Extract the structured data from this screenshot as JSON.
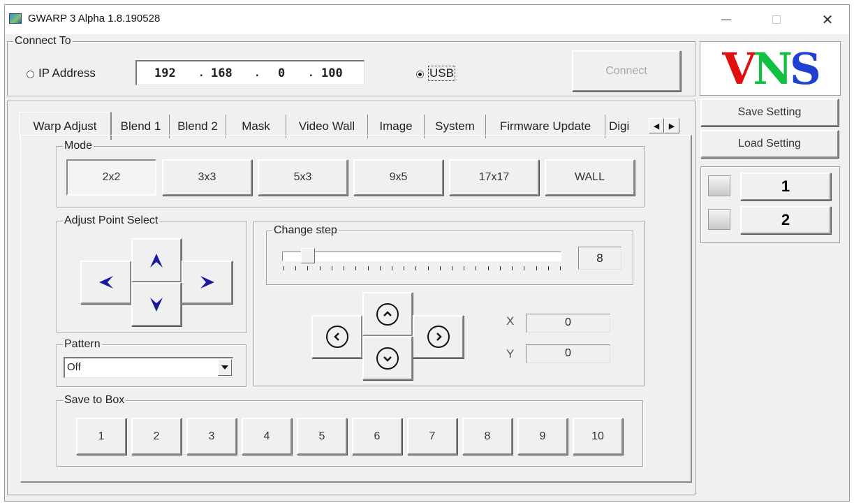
{
  "window": {
    "title": "GWARP 3 Alpha 1.8.190528",
    "minimize_icon": "minimize-icon",
    "maximize_icon": "maximize-icon",
    "close_icon": "close-icon",
    "close_glyph": "✕"
  },
  "connect": {
    "group_label": "Connect To",
    "ip_label": "IP Address",
    "ip_selected": false,
    "ip_octets": [
      "192",
      "168",
      "0",
      "100"
    ],
    "ip_separator": ".",
    "usb_label": "USB",
    "usb_selected": true,
    "connect_button": "Connect"
  },
  "logo": {
    "letters": [
      "V",
      "N",
      "S"
    ],
    "colors": [
      "#e01010",
      "#10c040",
      "#2040d0"
    ]
  },
  "settings": {
    "save": "Save Setting",
    "load": "Load Setting"
  },
  "channels": [
    "1",
    "2"
  ],
  "tabs": {
    "items": [
      "Warp Adjust",
      "Blend 1",
      "Blend 2",
      "Mask",
      "Video Wall",
      "Image",
      "System",
      "Firmware Update",
      "Digi"
    ],
    "active_index": 0,
    "scroll_left": "◀",
    "scroll_right": "▶"
  },
  "mode": {
    "group_label": "Mode",
    "options": [
      "2x2",
      "3x3",
      "5x3",
      "9x5",
      "17x17",
      "WALL"
    ],
    "selected_index": 0
  },
  "adjust_point": {
    "group_label": "Adjust Point Select",
    "icons": [
      "arrow-left-icon",
      "arrow-up-icon",
      "arrow-right-icon",
      "arrow-down-icon"
    ],
    "arrow_color": "#1a1aa0"
  },
  "change_step": {
    "group_label": "Change step",
    "value": "8",
    "slider_fraction": 0.07,
    "nav_icons": [
      "chevron-left-circle-icon",
      "chevron-up-circle-icon",
      "chevron-right-circle-icon",
      "chevron-down-circle-icon"
    ]
  },
  "coords": {
    "x_label": "X",
    "x_value": "0",
    "y_label": "Y",
    "y_value": "0"
  },
  "pattern": {
    "group_label": "Pattern",
    "selected": "Off",
    "dropdown_icon": "dropdown-arrow-icon"
  },
  "save_box": {
    "group_label": "Save to Box",
    "slots": [
      "1",
      "2",
      "3",
      "4",
      "5",
      "6",
      "7",
      "8",
      "9",
      "10"
    ]
  }
}
